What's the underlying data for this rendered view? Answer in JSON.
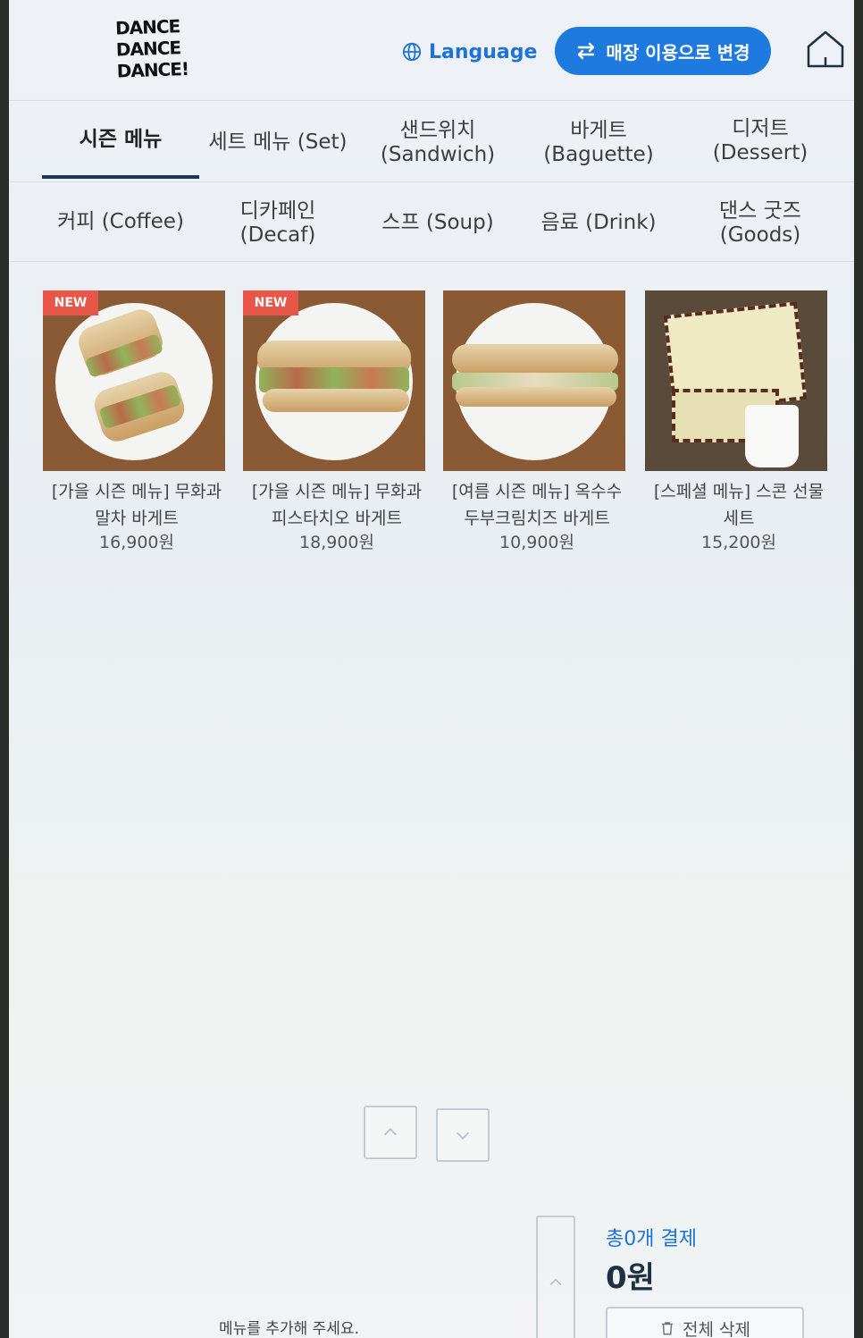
{
  "header": {
    "logo_lines": [
      "DANCE",
      "DANCE",
      "DANCE!"
    ],
    "language_label": "Language",
    "mode_button_label": "매장 이용으로 변경"
  },
  "tabs_row1": [
    {
      "label": "시즌 메뉴",
      "active": true
    },
    {
      "label": "세트 메뉴 (Set)",
      "active": false
    },
    {
      "label": "샌드위치\n(Sandwich)",
      "active": false
    },
    {
      "label": "바게트\n(Baguette)",
      "active": false
    },
    {
      "label": "디저트\n(Dessert)",
      "active": false
    }
  ],
  "tabs_row2": [
    {
      "label": "커피 (Coffee)"
    },
    {
      "label": "디카페인\n(Decaf)"
    },
    {
      "label": "스프 (Soup)"
    },
    {
      "label": "음료 (Drink)"
    },
    {
      "label": "댄스 굿즈\n(Goods)"
    }
  ],
  "products": [
    {
      "badge": "NEW",
      "name_line1": "[가을 시즌 메뉴] 무화과",
      "name_line2": "말차 바게트",
      "price": "16,900원"
    },
    {
      "badge": "NEW",
      "name_line1": "[가을 시즌 메뉴] 무화과",
      "name_line2": "피스타치오 바게트",
      "price": "18,900원"
    },
    {
      "badge": "",
      "name_line1": "[여름 시즌 메뉴] 옥수수",
      "name_line2": "두부크림치즈 바게트",
      "price": "10,900원"
    },
    {
      "badge": "",
      "name_line1": "[스페셜 메뉴] 스콘 선물",
      "name_line2": "세트",
      "price": "15,200원"
    }
  ],
  "cart": {
    "hint": "메뉴를 추가해 주세요.",
    "total_label": "총0개 결제",
    "total_amount": "0원",
    "clear_label": "전체 삭제"
  },
  "colors": {
    "accent": "#1f7ae0",
    "badge": "#e8564a",
    "active_tab_underline": "#1d3557"
  }
}
